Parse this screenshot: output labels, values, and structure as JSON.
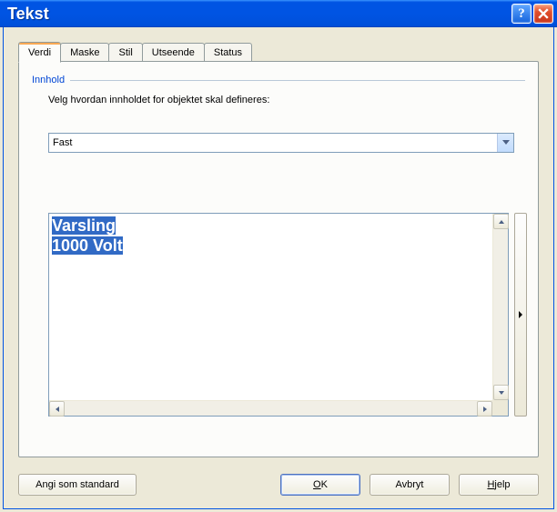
{
  "title": "Tekst",
  "tabs": [
    {
      "label": "Verdi"
    },
    {
      "label": "Maske"
    },
    {
      "label": "Stil"
    },
    {
      "label": "Utseende"
    },
    {
      "label": "Status"
    }
  ],
  "group": {
    "label": "Innhold",
    "instruction": "Velg hvordan innholdet for objektet skal defineres:"
  },
  "combo": {
    "value": "Fast"
  },
  "content": {
    "line1": "Varsling",
    "line2": "1000 Volt"
  },
  "buttons": {
    "set_default": "Angi som standard",
    "ok_pre": "",
    "ok_mn": "O",
    "ok_post": "K",
    "cancel": "Avbryt",
    "help_pre": "",
    "help_mn": "H",
    "help_post": "jelp"
  }
}
